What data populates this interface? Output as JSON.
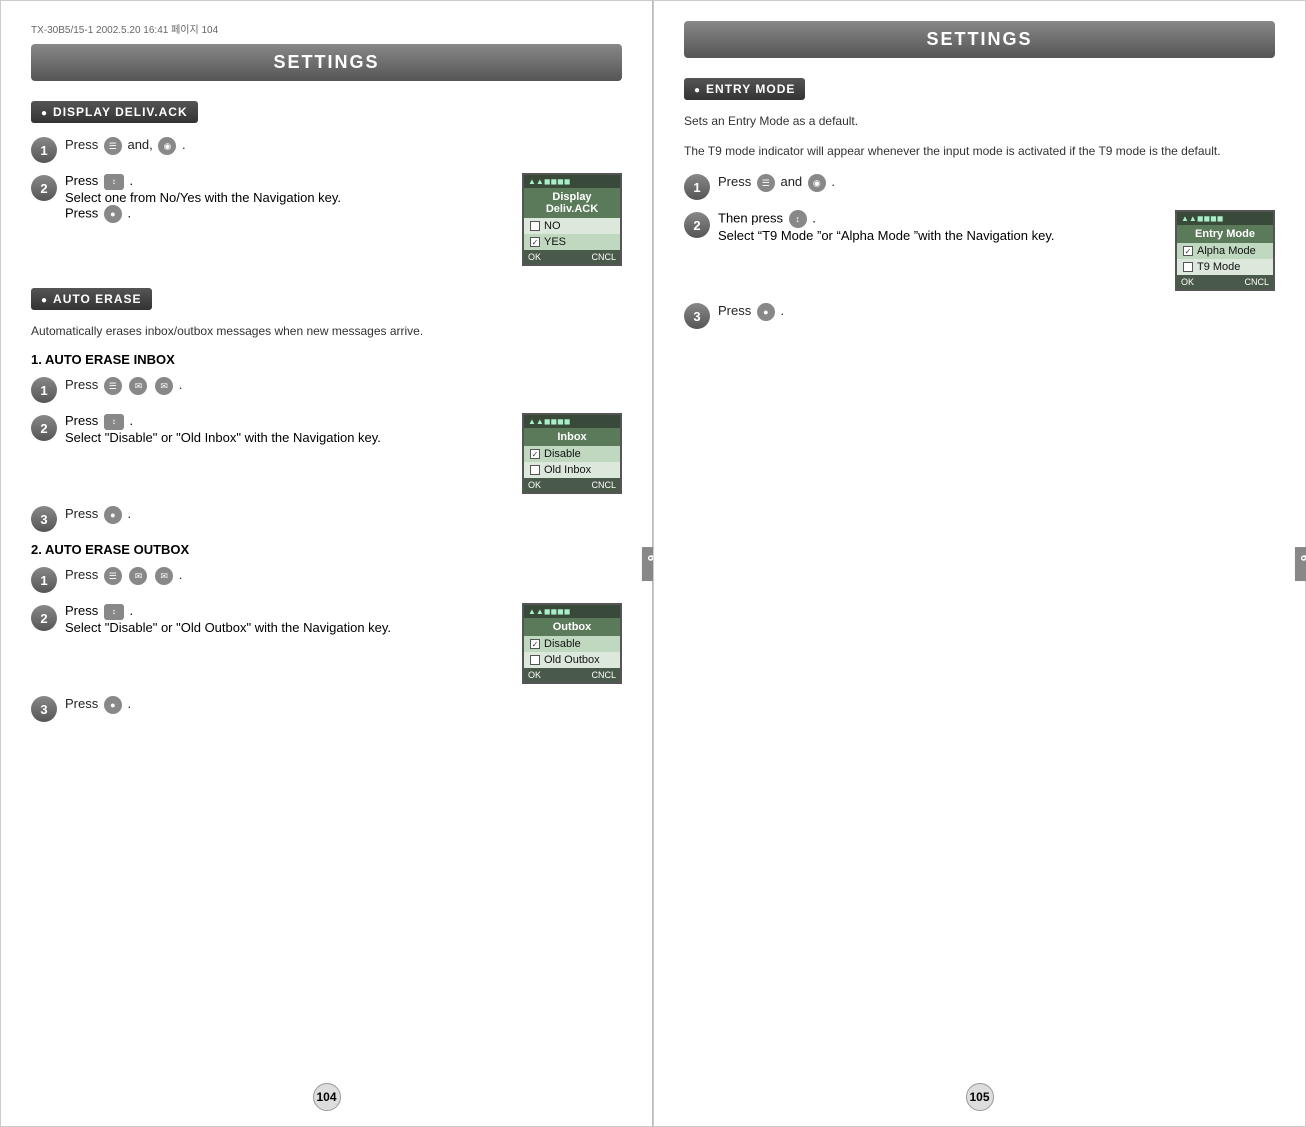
{
  "left_page": {
    "file_info": "TX-30B5/15-1  2002.5.20 16:41 페이지 104",
    "header": "SETTINGS",
    "section1": {
      "title": "DISPLAY DELIV.ACK",
      "steps": [
        {
          "num": "1",
          "text": "Press  and,  ."
        },
        {
          "num": "2",
          "text": "Press  .\nSelect one from No/Yes with the Navigation key.\nPress  ."
        }
      ],
      "screen": {
        "title": "Display Deliv.ACK",
        "items": [
          "NO",
          "YES"
        ],
        "checked": 1,
        "footer_left": "OK",
        "footer_right": "CNCL"
      }
    },
    "section2": {
      "title": "AUTO ERASE",
      "description": "Automatically erases inbox/outbox messages when new messages arrive.",
      "subsection1": {
        "label": "1. AUTO ERASE INBOX",
        "steps": [
          {
            "num": "1",
            "text": "Press  ."
          },
          {
            "num": "2",
            "text": "Press  .\nSelect \"Disable\" or \"Old Inbox\"\nwith the Navigation key."
          },
          {
            "num": "3",
            "text": "Press  ."
          }
        ],
        "screen": {
          "title": "Inbox",
          "items": [
            "Disable",
            "Old Inbox"
          ],
          "checked": 0,
          "footer_left": "OK",
          "footer_right": "CNCL"
        }
      },
      "subsection2": {
        "label": "2. AUTO ERASE OUTBOX",
        "steps": [
          {
            "num": "1",
            "text": "Press  ."
          },
          {
            "num": "2",
            "text": "Press  .\nSelect \"Disable\" or \"Old Outbox\"\nwith the Navigation key."
          },
          {
            "num": "3",
            "text": "Press  ."
          }
        ],
        "screen": {
          "title": "Outbox",
          "items": [
            "Disable",
            "Old Outbox"
          ],
          "checked": 0,
          "footer_left": "OK",
          "footer_right": "CNCL"
        }
      }
    },
    "page_number": "104"
  },
  "right_page": {
    "header": "SETTINGS",
    "section1": {
      "title": "ENTRY MODE",
      "description1": "Sets an Entry Mode as a default.",
      "description2": "The T9 mode indicator will appear whenever the input mode is activated if the T9 mode is the default.",
      "steps": [
        {
          "num": "1",
          "text": "Press  and  ."
        },
        {
          "num": "2",
          "text": "Then press  .\nSelect “T9 Mode”or “Alpha Mode”with the Navigation key."
        },
        {
          "num": "3",
          "text": "Press  ."
        }
      ],
      "screen": {
        "title": "Entry Mode",
        "items": [
          "Alpha Mode",
          "T9 Mode"
        ],
        "checked": 0,
        "footer_left": "OK",
        "footer_right": "CNCL"
      }
    },
    "page_number": "105"
  },
  "labels": {
    "press": "Press",
    "and": "and,",
    "then_press": "Then press",
    "select_no_yes": "Select one from No/Yes with the Navigation key.",
    "select_disable_inbox": "Select \"Disable\" or \"Old Inbox\" with the Navigation key.",
    "select_disable_outbox": "Select \"Disable\" or \"Old Outbox\" with the Navigation key.",
    "select_t9_alpha": "Select “T9 Mode ”or “Alpha Mode ”with the Navigation key.",
    "auto_erase_desc": "Automatically erases inbox/outbox messages when new messages arrive.",
    "entry_mode_desc1": "Sets an Entry Mode as a default.",
    "entry_mode_desc2": "The T9 mode indicator will appear whenever the input mode is activated if the T9 mode is the default.",
    "ch_label": "CH 6",
    "subsection1": "1. AUTO ERASE INBOX",
    "subsection2": "2. AUTO ERASE OUTBOX"
  }
}
